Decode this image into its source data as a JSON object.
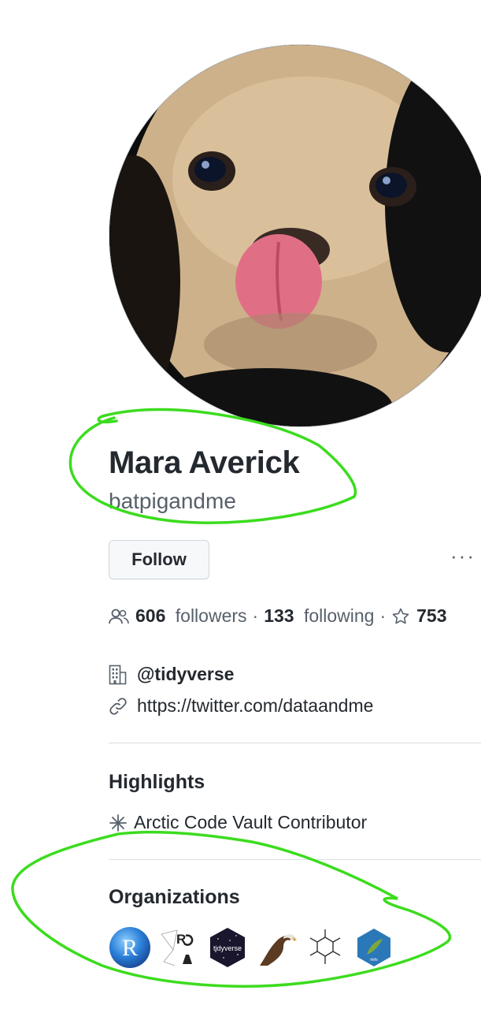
{
  "profile": {
    "full_name": "Mara Averick",
    "username": "batpigandme",
    "avatar_alt": "avatar"
  },
  "actions": {
    "follow_label": "Follow",
    "more_label": "···"
  },
  "stats": {
    "followers_count": "606",
    "followers_label": "followers",
    "separator": "·",
    "following_count": "133",
    "following_label": "following",
    "stars_count": "753"
  },
  "details": {
    "organization": "@tidyverse",
    "website": "https://twitter.com/dataandme"
  },
  "highlights": {
    "title": "Highlights",
    "items": [
      {
        "label": "Arctic Code Vault Contributor",
        "icon": "snowflake-icon"
      }
    ]
  },
  "organizations": {
    "title": "Organizations",
    "items": [
      {
        "name": "R",
        "icon": "r-logo"
      },
      {
        "name": "RO",
        "icon": "ropensci-logo"
      },
      {
        "name": "tidyverse",
        "icon": "tidyverse-hex"
      },
      {
        "name": "eagle",
        "icon": "eagle-logo"
      },
      {
        "name": "molecule",
        "icon": "molecule-logo"
      },
      {
        "name": "hex",
        "icon": "hex-logo"
      }
    ]
  },
  "annotation_color": "#3cdc1e"
}
